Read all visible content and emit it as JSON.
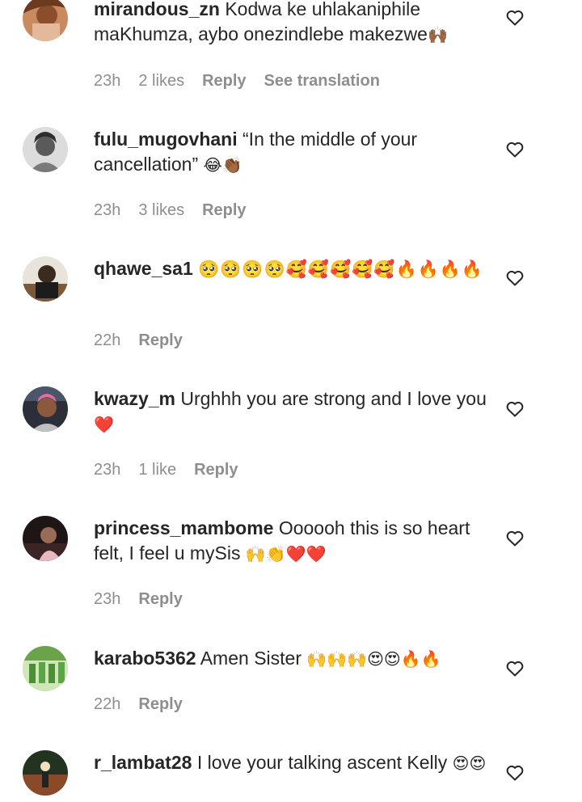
{
  "comments": [
    {
      "username": "mirandous_zn",
      "text": "Kodwa ke uhlakaniphile maKhumza, aybo onezindlebe makezwe",
      "emoji": "🙌🏾",
      "time": "23h",
      "likes": "2 likes",
      "reply": "Reply",
      "translate": "See translation"
    },
    {
      "username": "fulu_mugovhani",
      "text": "“In the middle of your cancellation”",
      "emoji": "😂👏🏾",
      "time": "23h",
      "likes": "3 likes",
      "reply": "Reply"
    },
    {
      "username": "qhawe_sa1",
      "text": "",
      "emoji": "🥺🥺🥺🥺🥰🥰🥰🥰🥰🔥🔥🔥🔥",
      "time": "22h",
      "reply": "Reply"
    },
    {
      "username": "kwazy_m",
      "text": "Urghhh you are strong and I love you",
      "emoji": "❤️",
      "time": "23h",
      "likes": "1 like",
      "reply": "Reply"
    },
    {
      "username": "princess_mambome",
      "text": "Oooooh this is so heart felt, I feel u mySis",
      "emoji": "🙌👏❤️❤️",
      "time": "23h",
      "reply": "Reply"
    },
    {
      "username": "karabo5362",
      "text": "Amen Sister",
      "emoji": "🙌🙌🙌😍😍🔥🔥",
      "time": "22h",
      "reply": "Reply"
    },
    {
      "username": "r_lambat28",
      "text": "I love your talking ascent Kelly",
      "emoji": "😍😍",
      "time": "",
      "reply": ""
    }
  ],
  "icons": {
    "like": "heart-outline-icon"
  },
  "colors": {
    "text": "#262626",
    "meta": "#8e8e8e",
    "background": "#ffffff"
  }
}
